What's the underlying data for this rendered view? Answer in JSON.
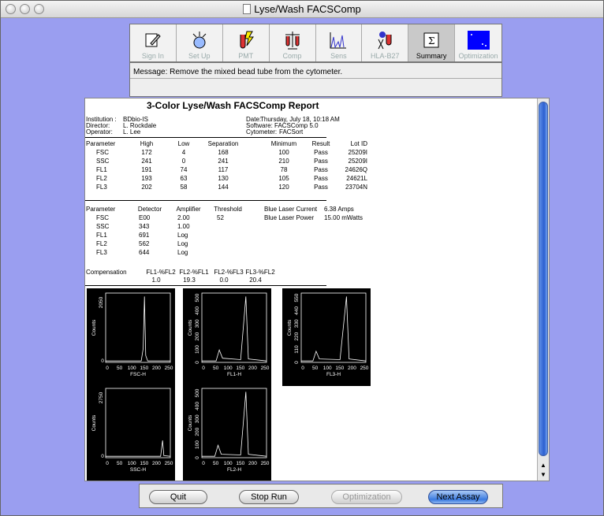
{
  "window": {
    "title": "Lyse/Wash FACSComp"
  },
  "toolbar": {
    "tools": [
      {
        "label": "Sign In",
        "icon": "sign-in-icon"
      },
      {
        "label": "Set Up",
        "icon": "setup-icon"
      },
      {
        "label": "PMT",
        "icon": "pmt-icon"
      },
      {
        "label": "Comp",
        "icon": "comp-icon"
      },
      {
        "label": "Sens",
        "icon": "sens-icon"
      },
      {
        "label": "HLA-B27",
        "icon": "hla-b27-icon"
      },
      {
        "label": "Summary",
        "icon": "summary-icon"
      },
      {
        "label": "Optimization",
        "icon": "optimization-icon"
      }
    ],
    "active": "Summary"
  },
  "message": {
    "text": "Message: Remove the mixed bead tube from the cytometer."
  },
  "report": {
    "title": "3-Color Lyse/Wash FACSComp Report",
    "info_left": {
      "institution_label": "Institution :",
      "institution": "BDbio-IS",
      "director_label": "Director:",
      "director": "L. Rockdale",
      "operator_label": "Operator:",
      "operator": "L. Lee"
    },
    "info_right": {
      "date_label": "Date:",
      "date": "Thursday, July 18, 10:18 AM",
      "software_label": "Software:",
      "software": "FACSComp 5.0",
      "cytometer_label": "Cytometer:",
      "cytometer": "FACSort"
    },
    "table1": {
      "headers": [
        "Parameter",
        "High",
        "Low",
        "Separation",
        "Minimum",
        "Result",
        "Lot ID"
      ],
      "rows": [
        [
          "FSC",
          "172",
          "4",
          "168",
          "100",
          "Pass",
          "25209I"
        ],
        [
          "SSC",
          "241",
          "0",
          "241",
          "210",
          "Pass",
          "25209I"
        ],
        [
          "FL1",
          "191",
          "74",
          "117",
          "78",
          "Pass",
          "24626Q"
        ],
        [
          "FL2",
          "193",
          "63",
          "130",
          "105",
          "Pass",
          "24621L"
        ],
        [
          "FL3",
          "202",
          "58",
          "144",
          "120",
          "Pass",
          "23704N"
        ]
      ]
    },
    "table2": {
      "headers": [
        "Parameter",
        "Detector",
        "Amplifier",
        "Threshold"
      ],
      "rows": [
        [
          "FSC",
          "E00",
          "2.00",
          "52"
        ],
        [
          "SSC",
          "343",
          "1.00",
          ""
        ],
        [
          "FL1",
          "691",
          "Log",
          ""
        ],
        [
          "FL2",
          "562",
          "Log",
          ""
        ],
        [
          "FL3",
          "644",
          "Log",
          ""
        ]
      ],
      "laser_current_label": "Blue Laser Current",
      "laser_current": "6.38 Amps",
      "laser_power_label": "Blue Laser Power",
      "laser_power": "15.00 mWatts"
    },
    "compensation": {
      "label": "Compensation",
      "headers": [
        "FL1-%FL2",
        "FL2-%FL1",
        "FL2-%FL3",
        "FL3-%FL2"
      ],
      "values": [
        "1.0",
        "19.3",
        "0.0",
        "20.4"
      ]
    },
    "histograms": [
      {
        "xlabel": "FSC-H",
        "ylabel": "Counts",
        "ymax": "2050",
        "yticks": [
          "0"
        ],
        "xticks": [
          "0",
          "50",
          "100",
          "150",
          "200",
          "250"
        ]
      },
      {
        "xlabel": "FL1-H",
        "ylabel": "Counts",
        "ymax": "",
        "yticks": [
          "0",
          "100",
          "200",
          "300",
          "400",
          "500"
        ],
        "xticks": [
          "0",
          "50",
          "100",
          "150",
          "200",
          "250"
        ]
      },
      {
        "xlabel": "FL3-H",
        "ylabel": "Counts",
        "ymax": "",
        "yticks": [
          "0",
          "110",
          "220",
          "330",
          "440",
          "550"
        ],
        "xticks": [
          "0",
          "50",
          "100",
          "150",
          "200",
          "250"
        ]
      },
      {
        "xlabel": "SSC-H",
        "ylabel": "Counts",
        "ymax": "2750",
        "yticks": [
          "0"
        ],
        "xticks": [
          "0",
          "50",
          "100",
          "150",
          "200",
          "250"
        ]
      },
      {
        "xlabel": "FL2-H",
        "ylabel": "Counts",
        "ymax": "",
        "yticks": [
          "0",
          "100",
          "200",
          "300",
          "400",
          "500"
        ],
        "xticks": [
          "0",
          "50",
          "100",
          "150",
          "200",
          "250"
        ]
      }
    ]
  },
  "buttons": {
    "quit": "Quit",
    "stop_run": "Stop Run",
    "optimization": "Optimization",
    "next_assay": "Next Assay"
  },
  "colors": {
    "background": "#9a9ef0",
    "accent": "#3b7be0"
  }
}
